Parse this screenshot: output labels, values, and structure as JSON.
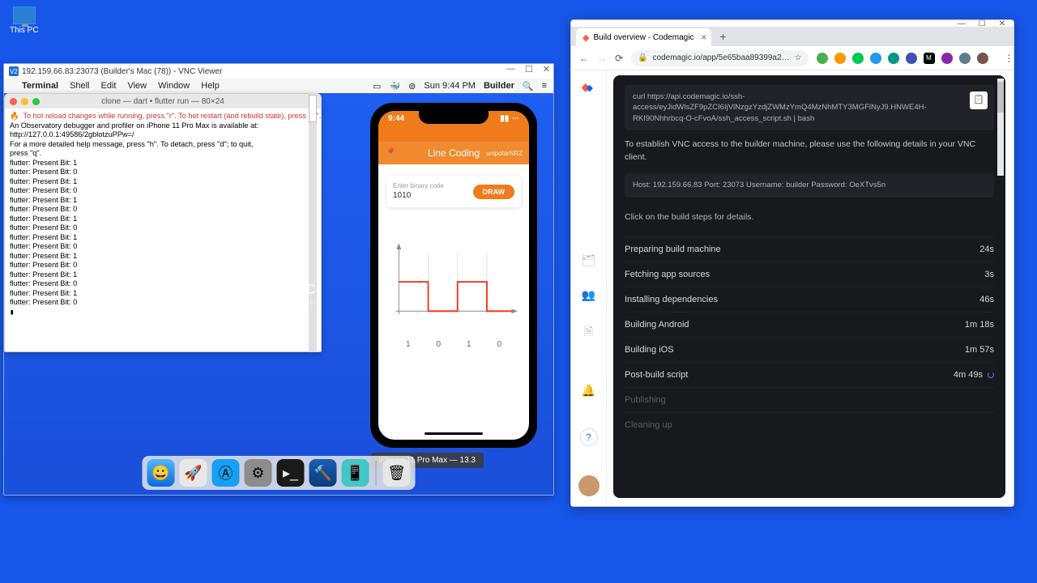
{
  "desktop": {
    "pc_label": "This PC"
  },
  "vnc": {
    "title": "192.159.66.83:23073 (Builder's Mac (78)) - VNC Viewer"
  },
  "mac_menu": {
    "app": "Terminal",
    "items": [
      "Shell",
      "Edit",
      "View",
      "Window",
      "Help"
    ],
    "clock": "Sun 9:44 PM",
    "builder": "Builder"
  },
  "terminal": {
    "title": "clone — dart • flutter run — 80×24",
    "hot_line": "  To hot reload changes while running, press \"r\". To hot restart (and rebuild state), press \"R\".",
    "body": "An Observatory debugger and profiler on iPhone 11 Pro Max is available at:\nhttp://127.0.0.1:49586/2gblotzuPPw=/\nFor a more detailed help message, press \"h\". To detach, press \"d\"; to quit,\npress \"q\".\nflutter: Present Bit: 1\nflutter: Present Bit: 0\nflutter: Present Bit: 1\nflutter: Present Bit: 0\nflutter: Present Bit: 1\nflutter: Present Bit: 0\nflutter: Present Bit: 1\nflutter: Present Bit: 0\nflutter: Present Bit: 1\nflutter: Present Bit: 0\nflutter: Present Bit: 1\nflutter: Present Bit: 0\nflutter: Present Bit: 1\nflutter: Present Bit: 0\nflutter: Present Bit: 1\nflutter: Present Bit: 0"
  },
  "phone": {
    "time": "9:44",
    "app_title": "Line Coding",
    "encoding": "unipolarNRZ",
    "input_label": "Enter binary code",
    "input_value": "1010",
    "draw_label": "DRAW",
    "sim_label": "iPhone 11 Pro Max — 13.3"
  },
  "chart_data": {
    "type": "line",
    "title": "",
    "xlabel": "",
    "ylabel": "",
    "x": [
      0,
      1,
      2,
      3,
      4
    ],
    "categories": [
      "1",
      "0",
      "1",
      "0"
    ],
    "values": [
      1,
      0,
      1,
      0
    ],
    "ylim": [
      0,
      1
    ],
    "series": [
      {
        "name": "signal",
        "x": [
          0,
          1,
          1,
          2,
          2,
          3,
          3,
          4
        ],
        "y": [
          1,
          1,
          0,
          0,
          1,
          1,
          0,
          0
        ]
      }
    ]
  },
  "host_brand": "codemagic",
  "host_brand_sub": "by Nevercode",
  "chrome": {
    "tab_title": "Build overview - Codemagic",
    "url": "codemagic.io/app/5e65baa89399a2…"
  },
  "codemagic": {
    "curl": "curl https://api.codemagic.io/ssh-access/eyJidWlsZF9pZCI6IjVlNzgzYzdjZWMzYmQ4MzNhMTY3MGFlNyJ9.HNWE4H-RKI90Nhhrbcq-O-cFvoA/ssh_access_script.sh | bash",
    "vnc_note": "To establish VNC access to the builder machine, please use the following details in your VNC client.",
    "host_line": "Host: 192.159.66.83 Port: 23073 Username: builder Password: OeXTvs5n",
    "steps_hint": "Click on the build steps for details.",
    "steps": [
      {
        "label": "Preparing build machine",
        "time": "24s"
      },
      {
        "label": "Fetching app sources",
        "time": "3s"
      },
      {
        "label": "Installing dependencies",
        "time": "46s"
      },
      {
        "label": "Building Android",
        "time": "1m 18s"
      },
      {
        "label": "Building iOS",
        "time": "1m 57s"
      },
      {
        "label": "Post-build script",
        "time": "4m 49s",
        "running": true
      },
      {
        "label": "Publishing",
        "dim": true
      },
      {
        "label": "Cleaning up",
        "dim": true
      }
    ]
  }
}
